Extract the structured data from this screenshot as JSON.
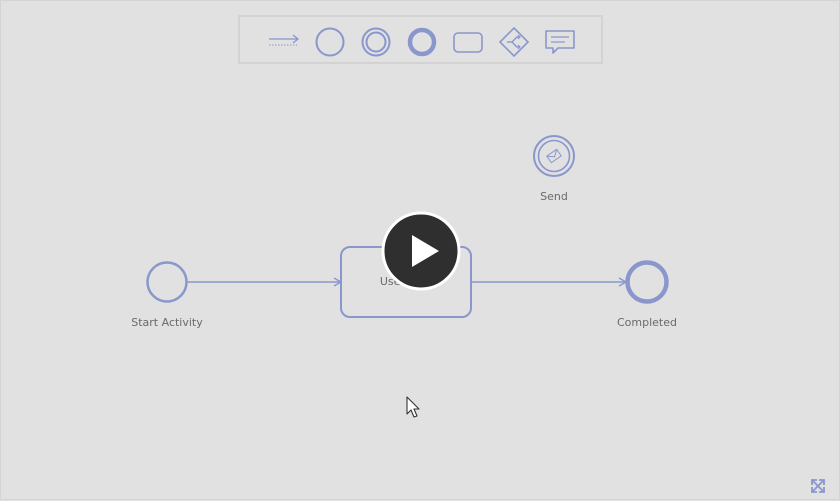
{
  "palette": {
    "tools": [
      {
        "name": "sequence-flow-tool",
        "icon": "dotted-arrow-icon"
      },
      {
        "name": "start-event-tool",
        "icon": "circle-thin-icon"
      },
      {
        "name": "intermediate-event-tool",
        "icon": "double-circle-icon"
      },
      {
        "name": "end-event-tool",
        "icon": "circle-thick-icon"
      },
      {
        "name": "task-tool",
        "icon": "rounded-rectangle-icon"
      },
      {
        "name": "gateway-tool",
        "icon": "diamond-branch-icon"
      },
      {
        "name": "annotation-tool",
        "icon": "speech-bubble-icon"
      }
    ]
  },
  "nodes": {
    "start": {
      "label": "Start Activity"
    },
    "task": {
      "label": "User Task"
    },
    "send": {
      "label": "Send",
      "icon": "send-envelope-icon"
    },
    "end": {
      "label": "Completed"
    }
  },
  "overlay": {
    "play_icon": "play-icon",
    "fullscreen_icon": "expand-icon"
  },
  "colors": {
    "accent": "#8a97cc",
    "background": "#e1e1e1",
    "label": "#6a6a6a",
    "play_bg": "#2f2f2f"
  }
}
